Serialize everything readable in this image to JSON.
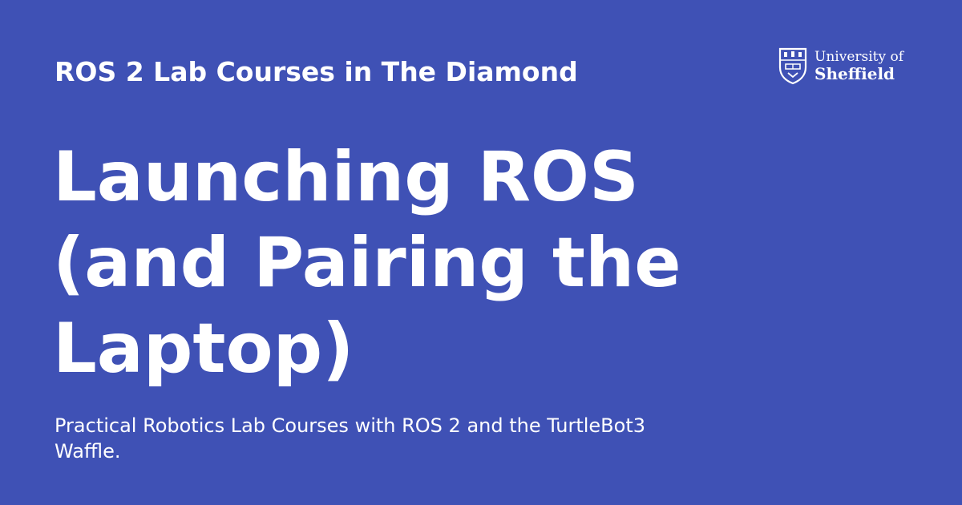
{
  "card": {
    "background_color": "#3f51b5",
    "text_color": "#ffffff",
    "kicker": "ROS 2 Lab Courses in The Diamond",
    "title_lines": [
      "Launching ROS",
      "(and Pairing the",
      "Laptop)"
    ],
    "description_lines": [
      "Practical Robotics Lab Courses with ROS 2 and the TurtleBot3",
      "Waffle."
    ]
  },
  "logo": {
    "icon": "university-crest-icon",
    "line1": "University of",
    "line2": "Sheffield"
  }
}
